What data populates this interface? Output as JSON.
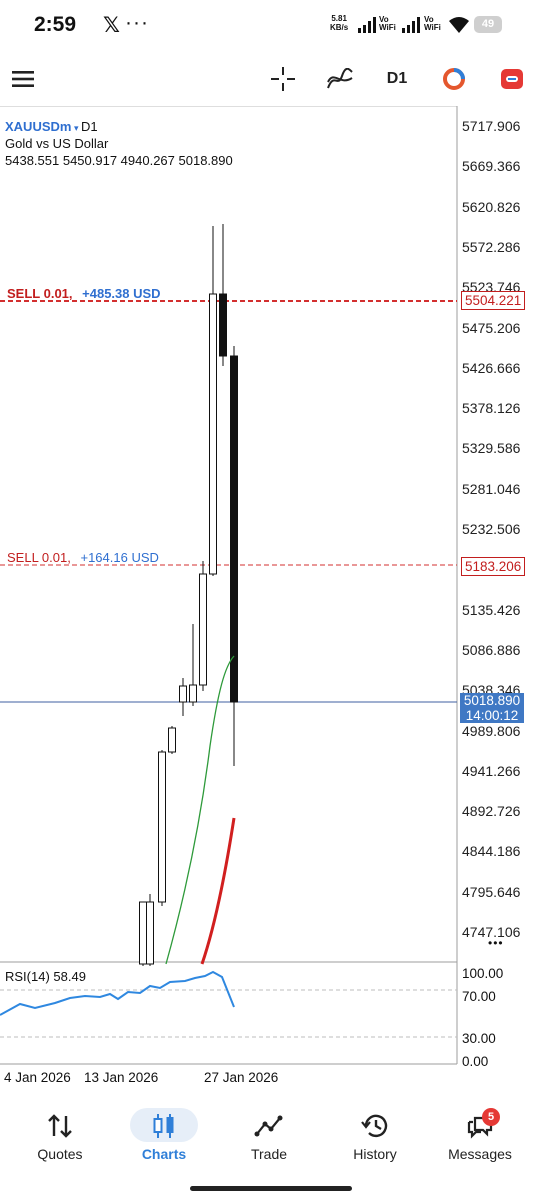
{
  "status_bar": {
    "time": "2:59",
    "x_glyph": "𝕏",
    "more_dots": "···",
    "net_speed": "5.81",
    "net_unit": "KB/s",
    "sim1_label": "Vo\nWiFi",
    "sim2_label": "Vo\nWiFi",
    "battery": "49"
  },
  "toolbar": {
    "timeframe": "D1"
  },
  "chart": {
    "symbol": "XAUUSDm",
    "timeframe": "D1",
    "description": "Gold vs US Dollar",
    "ohlc": "5438.551 5450.917 4940.267 5018.890",
    "price_axis": [
      "5717.906",
      "5669.366",
      "5620.826",
      "5572.286",
      "5523.746",
      "5475.206",
      "5426.666",
      "5378.126",
      "5329.586",
      "5281.046",
      "5232.506",
      "5135.426",
      "5086.886",
      "5038.346",
      "4989.806",
      "4941.266",
      "4892.726",
      "4844.186",
      "4795.646",
      "4747.106"
    ],
    "orders": [
      {
        "label": "SELL 0.01,",
        "profit": "+485.38 USD",
        "price": "5504.221"
      },
      {
        "label": "SELL 0.01,",
        "profit": "+164.16 USD",
        "price": "5183.206"
      }
    ],
    "current_price": "5018.890",
    "countdown": "14:00:12",
    "x_labels": [
      "4 Jan 2026",
      "13 Jan 2026",
      "27 Jan 2026"
    ],
    "more_glyph": "•••",
    "rsi": {
      "label": "RSI(14) 58.49",
      "levels": [
        "100.00",
        "70.00",
        "30.00",
        "0.00"
      ]
    },
    "colors": {
      "sell_line": "#d32f2f",
      "current_line": "#3f5fa0",
      "ma_fast": "#2e9a3a",
      "ma_slow": "#d11f1f",
      "rsi_line": "#2f88e0"
    }
  },
  "nav": {
    "items": [
      "Quotes",
      "Charts",
      "Trade",
      "History",
      "Messages"
    ],
    "active": "Charts",
    "messages_badge": "5"
  }
}
